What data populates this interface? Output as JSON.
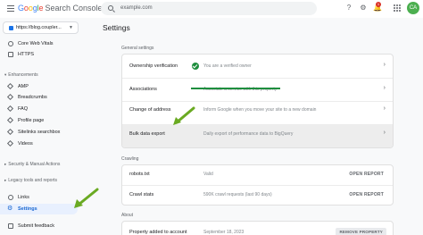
{
  "header": {
    "logo_google": [
      "G",
      "o",
      "o",
      "g",
      "l",
      "e"
    ],
    "logo_product": "Search Console",
    "search_text": "example.com",
    "help_icon": "help-icon",
    "settings_icon": "gear-icon",
    "bell_icon": "bell-icon",
    "bell_count": "1",
    "apps_icon": "apps-grid-icon",
    "avatar_initials": "CA"
  },
  "sidebar": {
    "property": "https://blog.coupler...",
    "items_top": [
      {
        "label": "Core Web Vitals"
      },
      {
        "label": "HTTPS"
      }
    ],
    "enhancements_title": "Enhancements",
    "enhancements": [
      {
        "label": "AMP"
      },
      {
        "label": "Breadcrumbs"
      },
      {
        "label": "FAQ"
      },
      {
        "label": "Profile page"
      },
      {
        "label": "Sitelinks searchbox"
      },
      {
        "label": "Videos"
      }
    ],
    "security_title": "Security & Manual Actions",
    "legacy_title": "Legacy tools and reports",
    "bottom": [
      {
        "label": "Links"
      },
      {
        "label": "Settings"
      },
      {
        "label": "Submit feedback"
      }
    ]
  },
  "main": {
    "title": "Settings",
    "general_title": "General settings",
    "general_rows": [
      {
        "label": "Ownership verification",
        "value": "You are a verified owner"
      },
      {
        "label": "Associations",
        "value": "Associate a service with this property"
      },
      {
        "label": "Change of address",
        "value": "Inform Google when you move your site to a new domain"
      },
      {
        "label": "Bulk data export",
        "value": "Daily export of performance data to BigQuery"
      }
    ],
    "crawling_title": "Crawling",
    "crawling_rows": [
      {
        "label": "robots.txt",
        "value": "Valid",
        "action": "OPEN REPORT"
      },
      {
        "label": "Crawl stats",
        "value": "590K crawl requests (last 90 days)",
        "action": "OPEN REPORT"
      }
    ],
    "about_title": "About",
    "about_rows": [
      {
        "label": "Property added to account",
        "value": "September 18, 2023",
        "action": "REMOVE PROPERTY"
      }
    ]
  },
  "colors": {
    "accent": "#1a73e8",
    "active_bg": "#e8f0fe",
    "verified_green": "#1e8e3e",
    "annotation_arrow": "#6aaa22"
  }
}
